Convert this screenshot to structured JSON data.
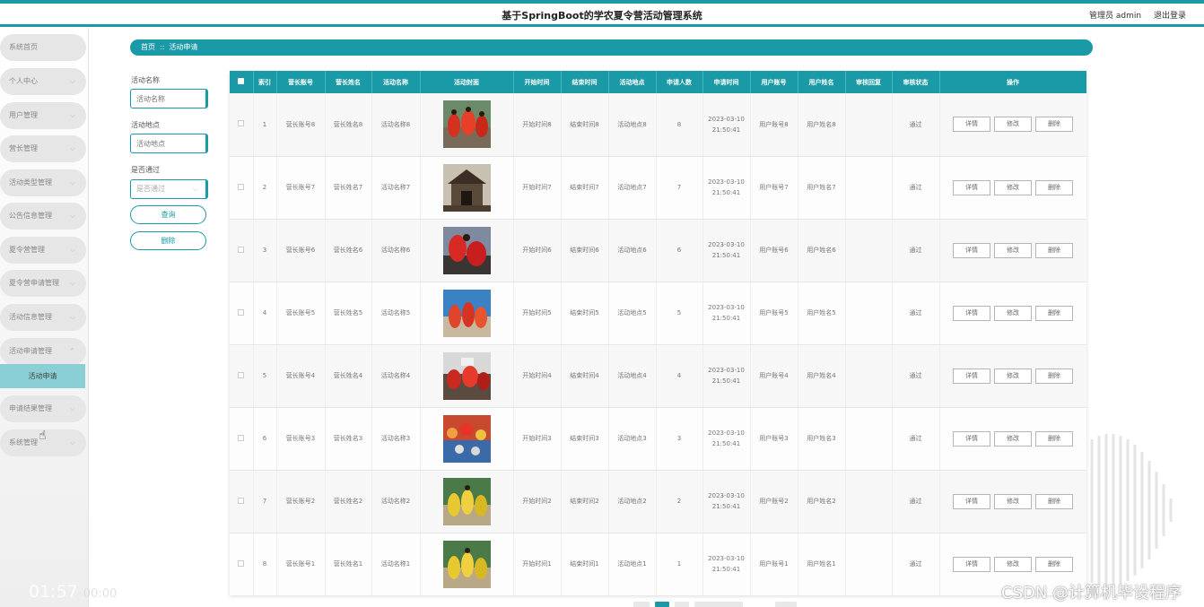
{
  "header": {
    "app_title": "基于SpringBoot的学农夏令营活动管理系统",
    "admin_label": "管理员 admin",
    "logout_label": "退出登录"
  },
  "colors": {
    "accent": "#1a9aa6",
    "submenu_active": "#8bcfd6",
    "sidebar_item": "#e6e6e6"
  },
  "sidebar": {
    "items": [
      {
        "label": "系统首页",
        "expandable": false
      },
      {
        "label": "个人中心",
        "expandable": true
      },
      {
        "label": "用户管理",
        "expandable": true
      },
      {
        "label": "营长管理",
        "expandable": true
      },
      {
        "label": "活动类型管理",
        "expandable": true
      },
      {
        "label": "公告信息管理",
        "expandable": true
      },
      {
        "label": "夏令营管理",
        "expandable": true
      },
      {
        "label": "夏令营申请管理",
        "expandable": true
      },
      {
        "label": "活动信息管理",
        "expandable": true
      },
      {
        "label": "活动申请管理",
        "expandable": true
      },
      {
        "label": "申请结果管理",
        "expandable": true
      },
      {
        "label": "系统管理",
        "expandable": true
      }
    ],
    "active_sub": "活动申请",
    "expand_icon": "chevron-down-icon"
  },
  "breadcrumb": {
    "home": "首页",
    "separator": "::",
    "current": "活动申请"
  },
  "filters": {
    "activity_name": {
      "label": "活动名称",
      "placeholder": "活动名称"
    },
    "activity_place": {
      "label": "活动地点",
      "placeholder": "活动地点"
    },
    "approved": {
      "label": "是否通过",
      "value": "是否通过"
    },
    "search_label": "查询",
    "delete_label": "删除"
  },
  "table": {
    "headers": [
      "索引",
      "营长账号",
      "营长姓名",
      "活动名称",
      "活动封面",
      "开始时间",
      "结束时间",
      "活动地点",
      "申请人数",
      "申请时间",
      "用户账号",
      "用户姓名",
      "审核回复",
      "审核状态",
      "操作"
    ],
    "actions": {
      "detail": "详情",
      "edit": "修改",
      "delete": "删除"
    },
    "rows": [
      {
        "index": "1",
        "leader_account": "营长账号8",
        "leader_name": "营长姓名8",
        "activity_name": "活动名称8",
        "cover": "red-dancers",
        "start": "开始时间8",
        "end": "结束时间8",
        "place": "活动地点8",
        "count": "8",
        "apply_date": "2023-03-10",
        "apply_time": "21:50:41",
        "user_account": "用户账号8",
        "user_name": "用户姓名8",
        "reply": "",
        "status": "通过"
      },
      {
        "index": "2",
        "leader_account": "营长账号7",
        "leader_name": "营长姓名7",
        "activity_name": "活动名称7",
        "cover": "building",
        "start": "开始时间7",
        "end": "结束时间7",
        "place": "活动地点7",
        "count": "7",
        "apply_date": "2023-03-10",
        "apply_time": "21:50:41",
        "user_account": "用户账号7",
        "user_name": "用户姓名7",
        "reply": "",
        "status": "通过"
      },
      {
        "index": "3",
        "leader_account": "营长账号6",
        "leader_name": "营长姓名6",
        "activity_name": "活动名称6",
        "cover": "festival",
        "start": "开始时间6",
        "end": "结束时间6",
        "place": "活动地点6",
        "count": "6",
        "apply_date": "2023-03-10",
        "apply_time": "21:50:41",
        "user_account": "用户账号6",
        "user_name": "用户姓名6",
        "reply": "",
        "status": "通过"
      },
      {
        "index": "4",
        "leader_account": "营长账号5",
        "leader_name": "营长姓名5",
        "activity_name": "活动名称5",
        "cover": "performers",
        "start": "开始时间5",
        "end": "结束时间5",
        "place": "活动地点5",
        "count": "5",
        "apply_date": "2023-03-10",
        "apply_time": "21:50:41",
        "user_account": "用户账号5",
        "user_name": "用户姓名5",
        "reply": "",
        "status": "通过"
      },
      {
        "index": "5",
        "leader_account": "营长账号4",
        "leader_name": "营长姓名4",
        "activity_name": "活动名称4",
        "cover": "crowd",
        "start": "开始时间4",
        "end": "结束时间4",
        "place": "活动地点4",
        "count": "4",
        "apply_date": "2023-03-10",
        "apply_time": "21:50:41",
        "user_account": "用户账号4",
        "user_name": "用户姓名4",
        "reply": "",
        "status": "通过"
      },
      {
        "index": "6",
        "leader_account": "营长账号3",
        "leader_name": "营长姓名3",
        "activity_name": "活动名称3",
        "cover": "parade",
        "start": "开始时间3",
        "end": "结束时间3",
        "place": "活动地点3",
        "count": "3",
        "apply_date": "2023-03-10",
        "apply_time": "21:50:41",
        "user_account": "用户账号3",
        "user_name": "用户姓名3",
        "reply": "",
        "status": "通过"
      },
      {
        "index": "7",
        "leader_account": "营长账号2",
        "leader_name": "营长姓名2",
        "activity_name": "活动名称2",
        "cover": "yellow-dancers",
        "start": "开始时间2",
        "end": "结束时间2",
        "place": "活动地点2",
        "count": "2",
        "apply_date": "2023-03-10",
        "apply_time": "21:50:41",
        "user_account": "用户账号2",
        "user_name": "用户姓名2",
        "reply": "",
        "status": "通过"
      },
      {
        "index": "8",
        "leader_account": "营长账号1",
        "leader_name": "营长姓名1",
        "activity_name": "活动名称1",
        "cover": "yellow-dancers",
        "start": "开始时间1",
        "end": "结束时间1",
        "place": "活动地点1",
        "count": "1",
        "apply_date": "2023-03-10",
        "apply_time": "21:50:41",
        "user_account": "用户账号1",
        "user_name": "用户姓名1",
        "reply": "",
        "status": "通过"
      }
    ]
  },
  "overlay": {
    "watermark": "CSDN @计算机毕设程序",
    "video_time": "01:57",
    "video_total": "00:00"
  }
}
